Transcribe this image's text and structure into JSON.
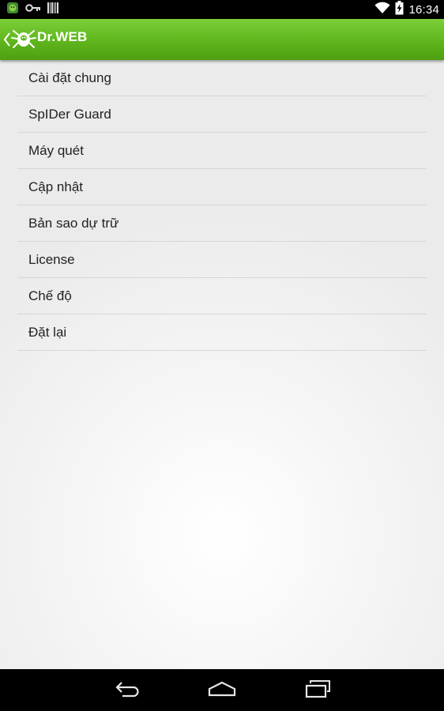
{
  "status_bar": {
    "time": "16:34",
    "left_icons": [
      "android-app-icon",
      "key-icon",
      "barcode-icon"
    ],
    "right_icons": [
      "wifi-icon",
      "battery-charging-icon"
    ]
  },
  "app_bar": {
    "title": "Dr.WEB",
    "logo": "drweb-spider-logo",
    "back": "back-chevron-icon",
    "color": "#5fb51c"
  },
  "menu": {
    "items": [
      {
        "label": "Cài đặt chung"
      },
      {
        "label": "SpIDer Guard"
      },
      {
        "label": "Máy quét"
      },
      {
        "label": "Cập nhật"
      },
      {
        "label": "Bản sao dự trữ"
      },
      {
        "label": "License"
      },
      {
        "label": "Chế độ"
      },
      {
        "label": "Đặt lại"
      }
    ]
  },
  "nav_bar": {
    "buttons": [
      "back-icon",
      "home-icon",
      "recent-apps-icon"
    ]
  }
}
